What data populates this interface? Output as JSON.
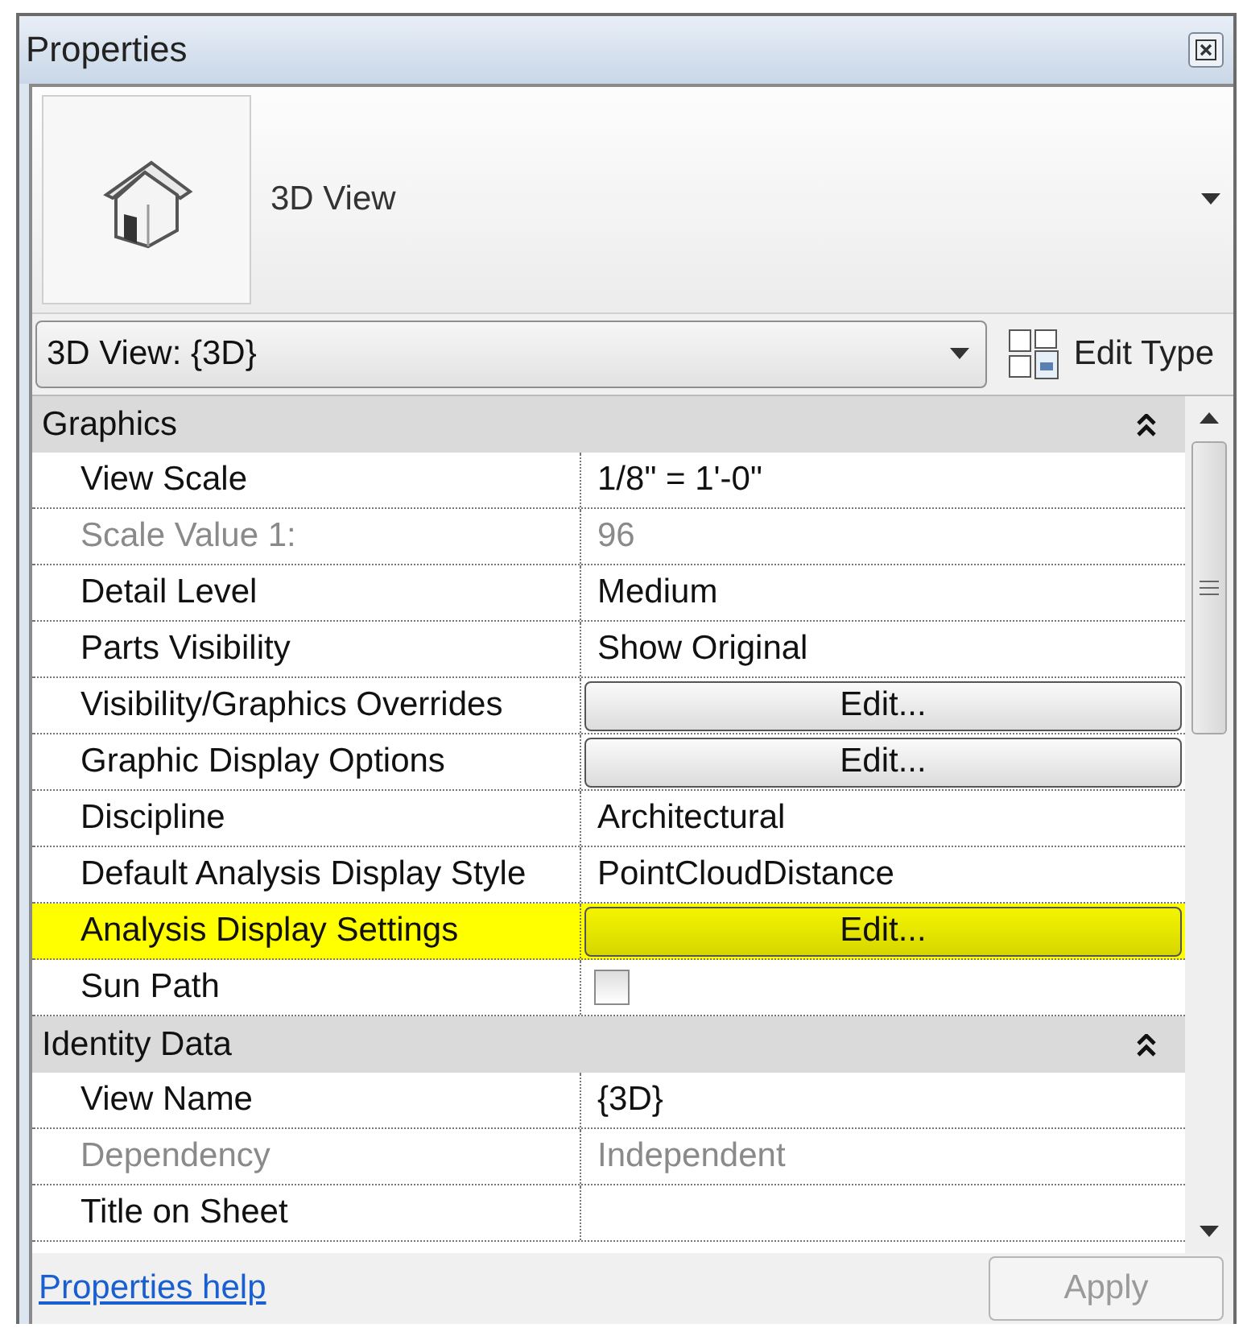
{
  "window": {
    "title": "Properties"
  },
  "type_preview": {
    "name": "3D View"
  },
  "type_selector": {
    "value": "3D View: {3D}"
  },
  "edit_type": {
    "label": "Edit Type"
  },
  "sections": [
    {
      "title": "Graphics",
      "expanded": true,
      "rows": [
        {
          "kind": "text",
          "label": "View Scale",
          "value": "1/8\" = 1'-0\"",
          "disabled": false,
          "highlighted": false
        },
        {
          "kind": "text",
          "label": "Scale Value    1:",
          "value": "96",
          "disabled": true,
          "highlighted": false
        },
        {
          "kind": "text",
          "label": "Detail Level",
          "value": "Medium",
          "disabled": false,
          "highlighted": false
        },
        {
          "kind": "text",
          "label": "Parts Visibility",
          "value": "Show Original",
          "disabled": false,
          "highlighted": false
        },
        {
          "kind": "button",
          "label": "Visibility/Graphics Overrides",
          "value": "Edit...",
          "disabled": false,
          "highlighted": false
        },
        {
          "kind": "button",
          "label": "Graphic Display Options",
          "value": "Edit...",
          "disabled": false,
          "highlighted": false
        },
        {
          "kind": "text",
          "label": "Discipline",
          "value": "Architectural",
          "disabled": false,
          "highlighted": false
        },
        {
          "kind": "text",
          "label": "Default Analysis Display Style",
          "value": "PointCloudDistance",
          "disabled": false,
          "highlighted": false
        },
        {
          "kind": "button",
          "label": "Analysis Display Settings",
          "value": "Edit...",
          "disabled": false,
          "highlighted": true
        },
        {
          "kind": "checkbox",
          "label": "Sun Path",
          "checked": false,
          "disabled": false,
          "highlighted": false
        }
      ]
    },
    {
      "title": "Identity Data",
      "expanded": true,
      "rows": [
        {
          "kind": "text",
          "label": "View Name",
          "value": "{3D}",
          "disabled": false,
          "highlighted": false
        },
        {
          "kind": "text",
          "label": "Dependency",
          "value": "Independent",
          "disabled": true,
          "highlighted": false
        },
        {
          "kind": "text",
          "label": "Title on Sheet",
          "disabled": false,
          "highlighted": false
        }
      ]
    }
  ],
  "footer": {
    "help_link": "Properties help",
    "apply": {
      "label": "Apply",
      "disabled": true
    }
  }
}
